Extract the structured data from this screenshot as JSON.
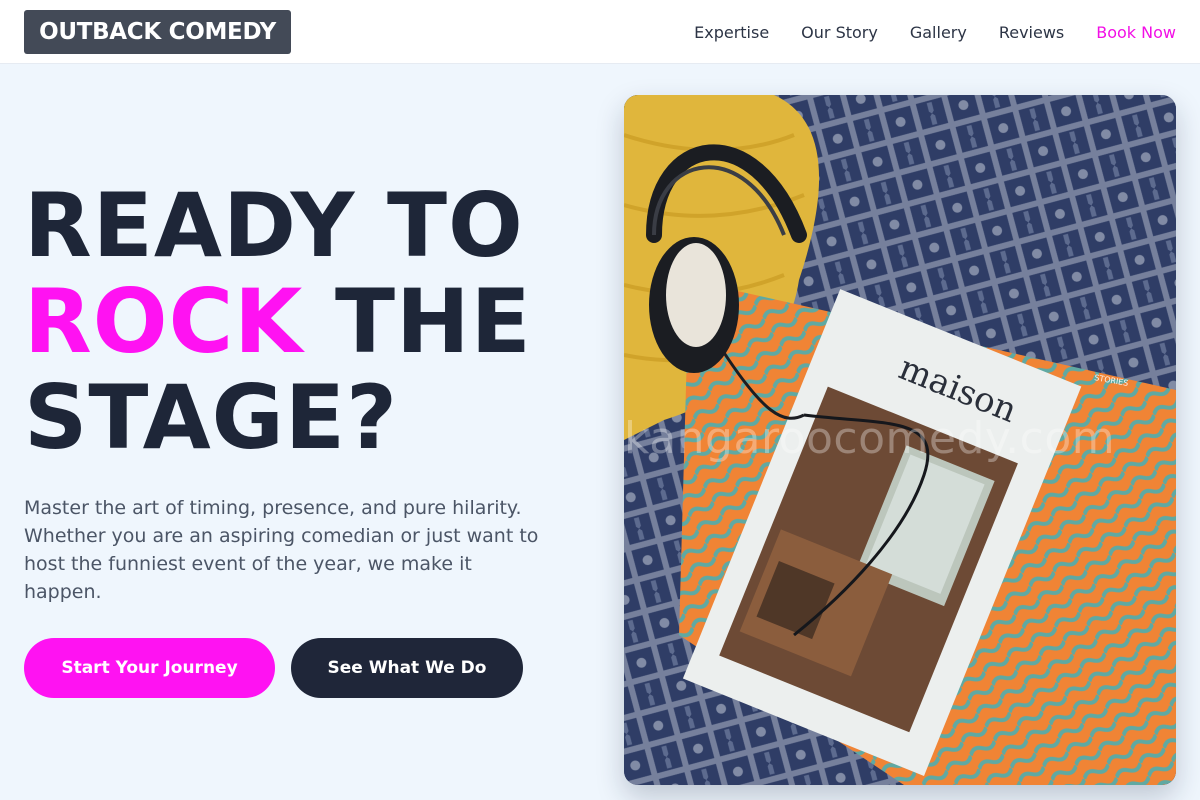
{
  "header": {
    "logo": "OUTBACK COMEDY",
    "nav": [
      {
        "label": "Expertise"
      },
      {
        "label": "Our Story"
      },
      {
        "label": "Gallery"
      },
      {
        "label": "Reviews"
      },
      {
        "label": "Book Now"
      }
    ]
  },
  "hero": {
    "headline_line1": "READY TO",
    "headline_highlight": "ROCK",
    "headline_line2_rest": " THE",
    "headline_line3": "STAGE?",
    "lead": "Master the art of timing, presence, and pure hilarity. Whether you are an aspiring comedian or just want to host the funniest event of the year, we make it happen.",
    "primary_cta": "Start Your Journey",
    "secondary_cta": "See What We Do"
  },
  "image": {
    "magazine_title": "maison",
    "watermark": "kangaroocomedy.com"
  },
  "colors": {
    "accent": "#ff12f2",
    "dark": "#1f2639",
    "page_bg": "#eff6fd",
    "logo_bg": "#434a57"
  }
}
